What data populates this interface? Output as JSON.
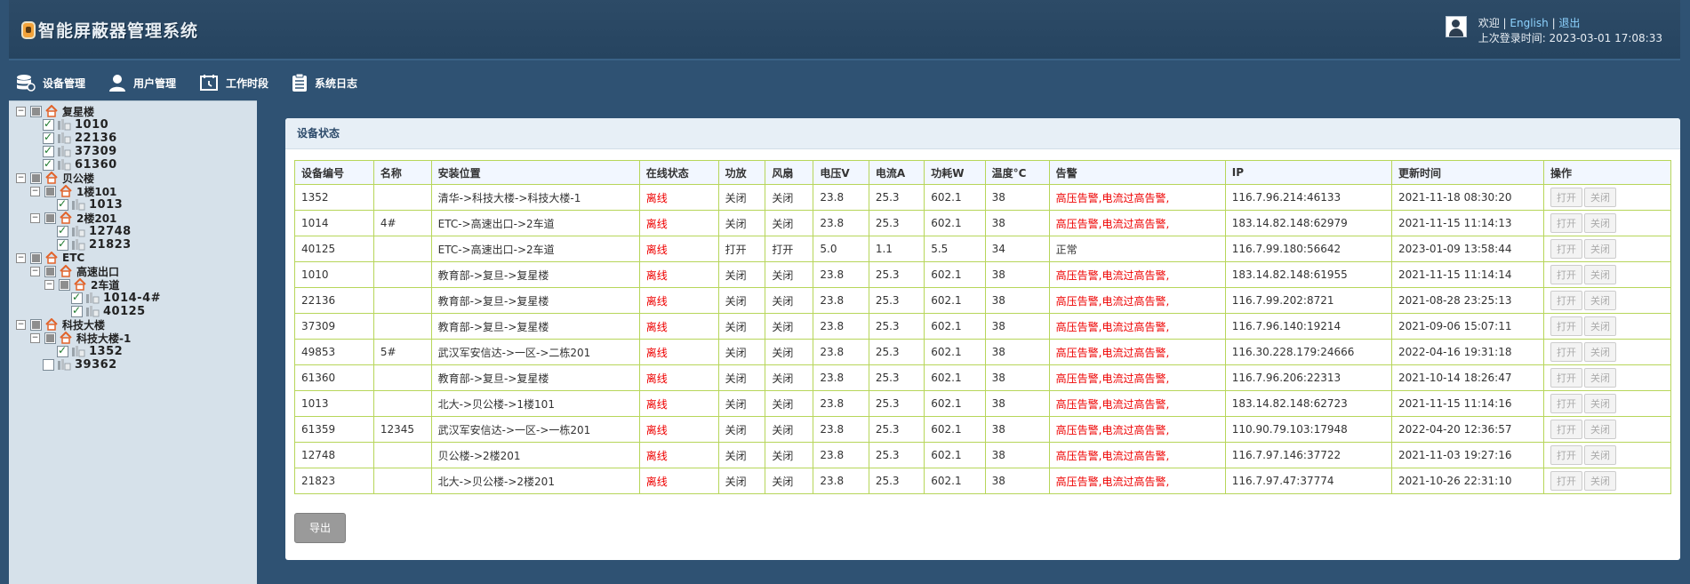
{
  "header": {
    "title": "智能屏蔽器管理系统",
    "welcome": "欢迎",
    "english_link": "English",
    "logout_link": "退出",
    "last_login": "上次登录时间: 2023-03-01 17:08:33"
  },
  "nav": [
    {
      "label": "设备管理",
      "icon": "database-icon"
    },
    {
      "label": "用户管理",
      "icon": "user-icon"
    },
    {
      "label": "工作时段",
      "icon": "clock-icon"
    },
    {
      "label": "系统日志",
      "icon": "log-icon"
    }
  ],
  "tree": [
    {
      "label": "复星楼",
      "type": "group",
      "state": "partial",
      "expanded": true
    },
    {
      "label": "1010",
      "type": "device",
      "state": "checked"
    },
    {
      "label": "22136",
      "type": "device",
      "state": "checked"
    },
    {
      "label": "37309",
      "type": "device",
      "state": "checked"
    },
    {
      "label": "61360",
      "type": "device",
      "state": "checked"
    },
    {
      "label": "贝公楼",
      "type": "group",
      "state": "partial",
      "expanded": true
    },
    {
      "label": "1楼101",
      "type": "group",
      "state": "partial",
      "expanded": true
    },
    {
      "label": "1013",
      "type": "device",
      "state": "checked"
    },
    {
      "label": "2楼201",
      "type": "group",
      "state": "partial",
      "expanded": true
    },
    {
      "label": "12748",
      "type": "device",
      "state": "checked"
    },
    {
      "label": "21823",
      "type": "device",
      "state": "checked"
    },
    {
      "label": "ETC",
      "type": "group",
      "state": "partial",
      "expanded": true
    },
    {
      "label": "高速出口",
      "type": "group",
      "state": "partial",
      "expanded": true
    },
    {
      "label": "2车道",
      "type": "group",
      "state": "partial",
      "expanded": true
    },
    {
      "label": "1014-4#",
      "type": "device",
      "state": "checked"
    },
    {
      "label": "40125",
      "type": "device",
      "state": "checked"
    },
    {
      "label": "科技大楼",
      "type": "group",
      "state": "partial",
      "expanded": true
    },
    {
      "label": "科技大楼-1",
      "type": "group",
      "state": "partial",
      "expanded": true
    },
    {
      "label": "1352",
      "type": "device",
      "state": "checked"
    },
    {
      "label": "39362",
      "type": "device",
      "state": "unchecked"
    }
  ],
  "panel": {
    "title": "设备状态",
    "export_label": "导出"
  },
  "table": {
    "headers": [
      "设备编号",
      "名称",
      "安装位置",
      "在线状态",
      "功放",
      "风扇",
      "电压V",
      "电流A",
      "功耗W",
      "温度°C",
      "告警",
      "IP",
      "更新时间",
      "操作"
    ],
    "open_label": "打开",
    "close_label": "关闭",
    "rows": [
      [
        "1352",
        "",
        "清华->科技大楼->科技大楼-1",
        "离线",
        "关闭",
        "关闭",
        "23.8",
        "25.3",
        "602.1",
        "38",
        "高压告警,电流过高告警,",
        "116.7.96.214:46133",
        "2021-11-18 08:30:20"
      ],
      [
        "1014",
        "4#",
        "ETC->高速出口->2车道",
        "离线",
        "关闭",
        "关闭",
        "23.8",
        "25.3",
        "602.1",
        "38",
        "高压告警,电流过高告警,",
        "183.14.82.148:62979",
        "2021-11-15 11:14:13"
      ],
      [
        "40125",
        "",
        "ETC->高速出口->2车道",
        "离线",
        "打开",
        "打开",
        "5.0",
        "1.1",
        "5.5",
        "34",
        "正常",
        "116.7.99.180:56642",
        "2023-01-09 13:58:44"
      ],
      [
        "1010",
        "",
        "教育部->复旦->复星楼",
        "离线",
        "关闭",
        "关闭",
        "23.8",
        "25.3",
        "602.1",
        "38",
        "高压告警,电流过高告警,",
        "183.14.82.148:61955",
        "2021-11-15 11:14:14"
      ],
      [
        "22136",
        "",
        "教育部->复旦->复星楼",
        "离线",
        "关闭",
        "关闭",
        "23.8",
        "25.3",
        "602.1",
        "38",
        "高压告警,电流过高告警,",
        "116.7.99.202:8721",
        "2021-08-28 23:25:13"
      ],
      [
        "37309",
        "",
        "教育部->复旦->复星楼",
        "离线",
        "关闭",
        "关闭",
        "23.8",
        "25.3",
        "602.1",
        "38",
        "高压告警,电流过高告警,",
        "116.7.96.140:19214",
        "2021-09-06 15:07:11"
      ],
      [
        "49853",
        "5#",
        "武汉军安信达->一区->二栋201",
        "离线",
        "关闭",
        "关闭",
        "23.8",
        "25.3",
        "602.1",
        "38",
        "高压告警,电流过高告警,",
        "116.30.228.179:24666",
        "2022-04-16 19:31:18"
      ],
      [
        "61360",
        "",
        "教育部->复旦->复星楼",
        "离线",
        "关闭",
        "关闭",
        "23.8",
        "25.3",
        "602.1",
        "38",
        "高压告警,电流过高告警,",
        "116.7.96.206:22313",
        "2021-10-14 18:26:47"
      ],
      [
        "1013",
        "",
        "北大->贝公楼->1楼101",
        "离线",
        "关闭",
        "关闭",
        "23.8",
        "25.3",
        "602.1",
        "38",
        "高压告警,电流过高告警,",
        "183.14.82.148:62723",
        "2021-11-15 11:14:16"
      ],
      [
        "61359",
        "12345",
        "武汉军安信达->一区->一栋201",
        "离线",
        "关闭",
        "关闭",
        "23.8",
        "25.3",
        "602.1",
        "38",
        "高压告警,电流过高告警,",
        "110.90.79.103:17948",
        "2022-04-20 12:36:57"
      ],
      [
        "12748",
        "",
        "贝公楼->2楼201",
        "离线",
        "关闭",
        "关闭",
        "23.8",
        "25.3",
        "602.1",
        "38",
        "高压告警,电流过高告警,",
        "116.7.97.146:37722",
        "2021-11-03 19:27:16"
      ],
      [
        "21823",
        "",
        "北大->贝公楼->2楼201",
        "离线",
        "关闭",
        "关闭",
        "23.8",
        "25.3",
        "602.1",
        "38",
        "高压告警,电流过高告警,",
        "116.7.97.47:37774",
        "2021-10-26 22:31:10"
      ]
    ]
  },
  "colors": {
    "background": "#2f5273",
    "sidebar": "#d6e1ea",
    "table_border": "#b7d65a",
    "alarm": "#ee0000",
    "link": "#8ed3ff"
  }
}
